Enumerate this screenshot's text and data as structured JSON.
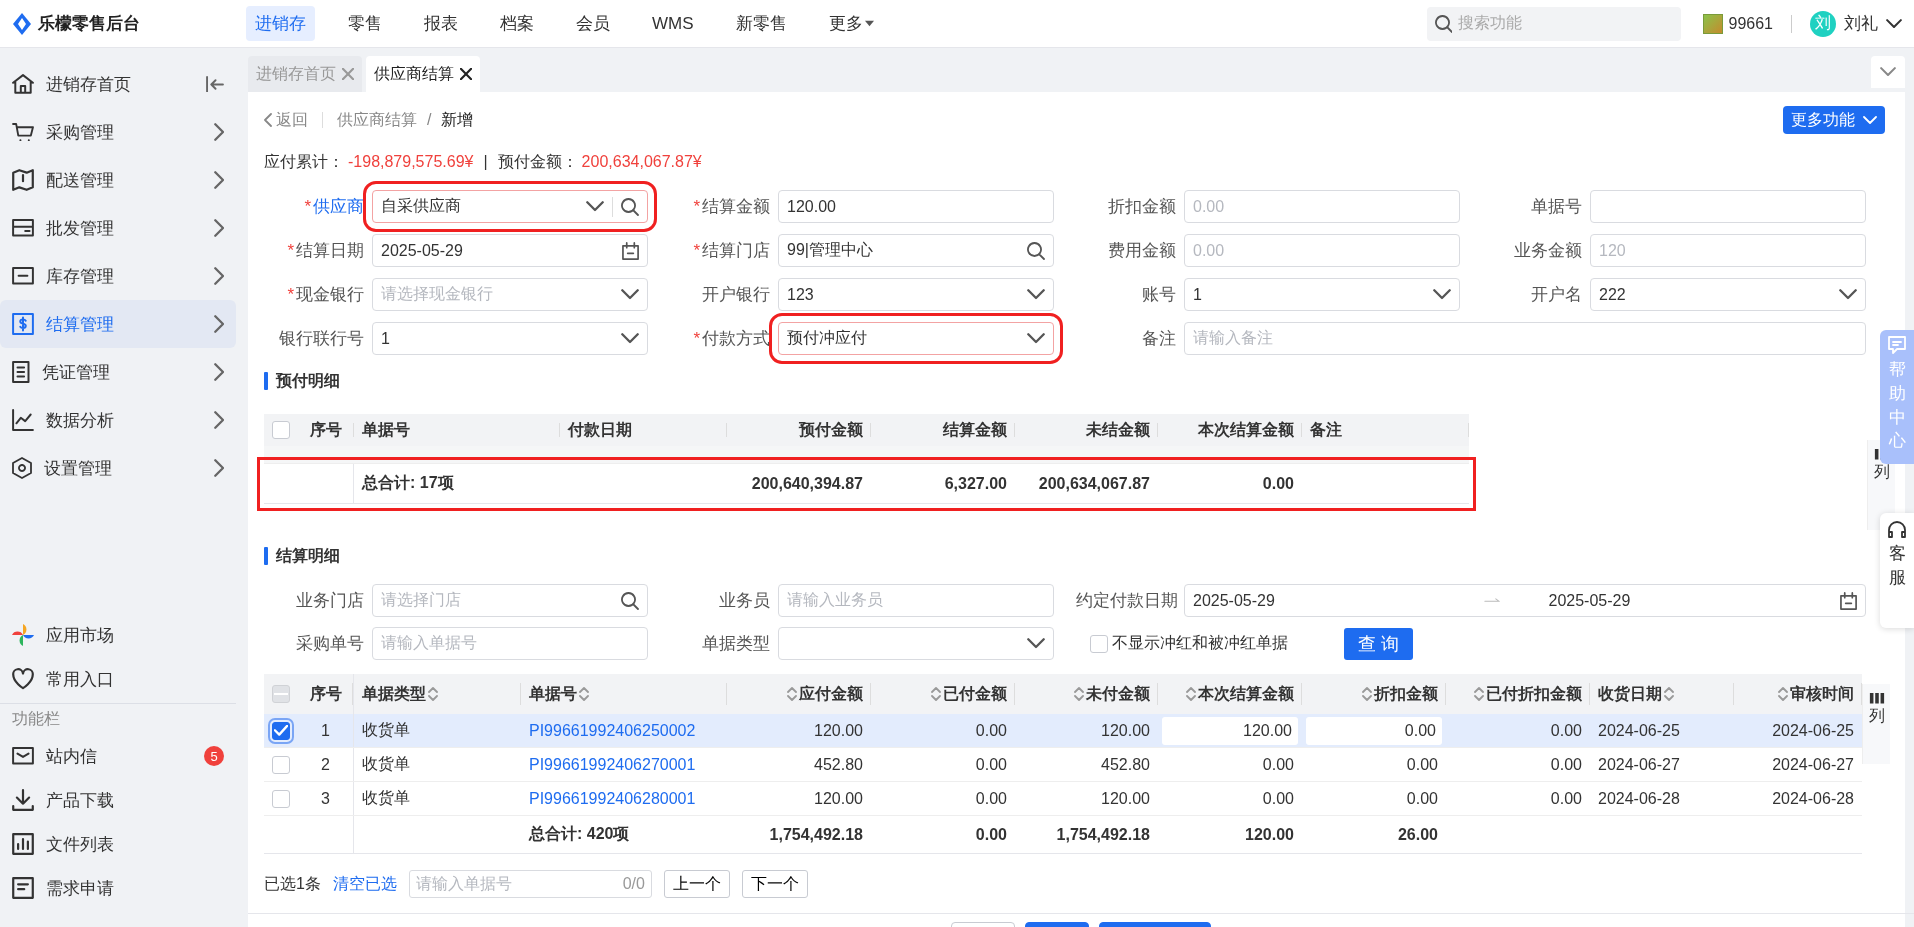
{
  "app": {
    "title": "乐檬零售后台"
  },
  "top_nav": [
    {
      "label": "进销存",
      "selected": true,
      "kind": "link"
    },
    {
      "label": "零售",
      "selected": false,
      "kind": "link"
    },
    {
      "label": "报表",
      "selected": false,
      "kind": "link"
    },
    {
      "label": "档案",
      "selected": false,
      "kind": "link"
    },
    {
      "label": "会员",
      "selected": false,
      "kind": "link"
    },
    {
      "label": "WMS",
      "selected": false,
      "kind": "link"
    },
    {
      "label": "新零售",
      "selected": false,
      "kind": "link"
    },
    {
      "label": "更多",
      "selected": false,
      "kind": "menu"
    }
  ],
  "search": {
    "placeholder": "搜索功能"
  },
  "store": {
    "code": "99661"
  },
  "user": {
    "avatar_text": "刘",
    "name": "刘礼"
  },
  "sidebar": {
    "items": [
      {
        "label": "进销存首页",
        "kind": "page",
        "selected": false
      },
      {
        "label": "采购管理",
        "kind": "group",
        "selected": false
      },
      {
        "label": "配送管理",
        "kind": "group",
        "selected": false
      },
      {
        "label": "批发管理",
        "kind": "group",
        "selected": false
      },
      {
        "label": "库存管理",
        "kind": "group",
        "selected": false
      },
      {
        "label": "结算管理",
        "kind": "group",
        "selected": true
      },
      {
        "label": "凭证管理",
        "kind": "group",
        "selected": false
      },
      {
        "label": "数据分析",
        "kind": "group",
        "selected": false
      },
      {
        "label": "设置管理",
        "kind": "group",
        "selected": false
      }
    ],
    "extra_items": [
      {
        "label": "应用市场"
      },
      {
        "label": "常用入口"
      }
    ],
    "section_title": "功能栏",
    "tool_items": [
      {
        "label": "站内信",
        "badge": "5"
      },
      {
        "label": "产品下载"
      },
      {
        "label": "文件列表"
      },
      {
        "label": "需求申请"
      }
    ]
  },
  "tabs": [
    {
      "label": "进销存首页",
      "selected": false
    },
    {
      "label": "供应商结算",
      "selected": true
    }
  ],
  "breadcrumb": {
    "back": "返回",
    "parent": "供应商结算",
    "separator": "/",
    "current": "新增"
  },
  "more_button": "更多功能",
  "summary": {
    "items": [
      {
        "label": "应付累计：",
        "value": "-198,879,575.69¥"
      },
      {
        "label": "预付金额：",
        "value": "200,634,067.87¥"
      }
    ],
    "separator": "|"
  },
  "form": {
    "required_mark": "*",
    "fields": [
      {
        "label": "供应商",
        "required": true,
        "label_link": true,
        "highlighted": true,
        "wide": false,
        "kind": "searchselect",
        "value": "自采供应商"
      },
      {
        "label": "结算金额",
        "required": true,
        "label_link": false,
        "highlighted": false,
        "wide": false,
        "kind": "text",
        "value": "120.00"
      },
      {
        "label": "折扣金额",
        "required": false,
        "label_link": false,
        "highlighted": false,
        "wide": false,
        "kind": "text",
        "placeholder": "0.00"
      },
      {
        "label": "单据号",
        "required": false,
        "label_link": false,
        "highlighted": false,
        "wide": false,
        "kind": "text"
      },
      {
        "label": "结算日期",
        "required": true,
        "label_link": false,
        "highlighted": false,
        "wide": false,
        "kind": "date",
        "value": "2025-05-29"
      },
      {
        "label": "结算门店",
        "required": true,
        "label_link": false,
        "highlighted": false,
        "wide": false,
        "kind": "search",
        "value": "99|管理中心"
      },
      {
        "label": "费用金额",
        "required": false,
        "label_link": false,
        "highlighted": false,
        "wide": false,
        "kind": "text",
        "placeholder": "0.00"
      },
      {
        "label": "业务金额",
        "required": false,
        "label_link": false,
        "highlighted": false,
        "wide": false,
        "kind": "text",
        "placeholder": "120"
      },
      {
        "label": "现金银行",
        "required": true,
        "label_link": false,
        "highlighted": false,
        "wide": false,
        "kind": "select",
        "placeholder": "请选择现金银行"
      },
      {
        "label": "开户银行",
        "required": false,
        "label_link": false,
        "highlighted": false,
        "wide": false,
        "kind": "select",
        "value": "123"
      },
      {
        "label": "账号",
        "required": false,
        "label_link": false,
        "highlighted": false,
        "wide": false,
        "kind": "select",
        "value": "1"
      },
      {
        "label": "开户名",
        "required": false,
        "label_link": false,
        "highlighted": false,
        "wide": false,
        "kind": "select",
        "value": "222"
      },
      {
        "label": "银行联行号",
        "required": false,
        "label_link": false,
        "highlighted": false,
        "wide": false,
        "kind": "select",
        "value": "1"
      },
      {
        "label": "付款方式",
        "required": true,
        "label_link": false,
        "highlighted": true,
        "wide": false,
        "kind": "select",
        "value": "预付冲应付"
      },
      {
        "label": "备注",
        "required": false,
        "label_link": false,
        "highlighted": false,
        "wide": true,
        "kind": "text",
        "placeholder": "请输入备注"
      }
    ]
  },
  "prepay": {
    "title": "预付明细",
    "column_settings": "列",
    "select_all": {
      "checked": false
    },
    "columns": [
      {
        "label": "序号",
        "kind": "index"
      },
      {
        "label": "单据号",
        "kind": "text"
      },
      {
        "label": "付款日期",
        "kind": "text"
      },
      {
        "label": "预付金额",
        "kind": "number"
      },
      {
        "label": "结算金额",
        "kind": "number"
      },
      {
        "label": "未结金额",
        "kind": "number"
      },
      {
        "label": "本次结算金额",
        "kind": "number"
      },
      {
        "label": "备注",
        "kind": "text"
      }
    ],
    "totals": {
      "label": "总合计: 17项",
      "values": [
        "200,640,394.87",
        "6,327.00",
        "200,634,067.87",
        "0.00"
      ],
      "highlighted": true
    }
  },
  "settlement": {
    "title": "结算明细",
    "filters": [
      {
        "label": "业务门店",
        "kind": "search",
        "placeholder": "请选择门店"
      },
      {
        "label": "业务员",
        "kind": "text",
        "placeholder": "请输入业务员"
      },
      {
        "label": "约定付款日期",
        "kind": "daterange",
        "start": "2025-05-29",
        "end": "2025-05-29"
      },
      {
        "label": "采购单号",
        "kind": "text",
        "placeholder": "请输入单据号"
      },
      {
        "label": "单据类型",
        "kind": "select"
      }
    ],
    "hide_reversed": {
      "label": "不显示冲红和被冲红单据",
      "checked": false
    },
    "query_button": "查 询",
    "column_settings": "列",
    "select_all": {
      "checked": false,
      "indeterminate": true
    },
    "columns": [
      {
        "label": "序号",
        "kind": "index",
        "sortable": false,
        "editable": false
      },
      {
        "label": "单据类型",
        "kind": "text",
        "sortable": true,
        "editable": false
      },
      {
        "label": "单据号",
        "kind": "link",
        "sortable": true,
        "editable": false
      },
      {
        "label": "应付金额",
        "kind": "number",
        "sortable": true,
        "editable": false
      },
      {
        "label": "已付金额",
        "kind": "number",
        "sortable": true,
        "editable": false
      },
      {
        "label": "未付金额",
        "kind": "number",
        "sortable": true,
        "editable": false
      },
      {
        "label": "本次结算金额",
        "kind": "number",
        "sortable": true,
        "editable": true
      },
      {
        "label": "折扣金额",
        "kind": "number",
        "sortable": true,
        "editable": true
      },
      {
        "label": "已付折扣金额",
        "kind": "number",
        "sortable": true,
        "editable": false
      },
      {
        "label": "收货日期",
        "kind": "text",
        "sortable": true,
        "editable": false
      },
      {
        "label": "审核时间",
        "kind": "date",
        "sortable": true,
        "editable": false
      }
    ],
    "rows": [
      {
        "selected": true,
        "cells": [
          "1",
          "收货单",
          "PI99661992406250002",
          "120.00",
          "0.00",
          "120.00",
          "120.00",
          "0.00",
          "0.00",
          "2024-06-25",
          "2024-06-25"
        ]
      },
      {
        "selected": false,
        "cells": [
          "2",
          "收货单",
          "PI99661992406270001",
          "452.80",
          "0.00",
          "452.80",
          "0.00",
          "0.00",
          "0.00",
          "2024-06-27",
          "2024-06-27"
        ]
      },
      {
        "selected": false,
        "cells": [
          "3",
          "收货单",
          "PI99661992406280001",
          "120.00",
          "0.00",
          "120.00",
          "0.00",
          "0.00",
          "0.00",
          "2024-06-28",
          "2024-06-28"
        ]
      }
    ],
    "totals": {
      "label": "总合计: 420项",
      "values": [
        "1,754,492.18",
        "0.00",
        "1,754,492.18",
        "120.00",
        "26.00"
      ]
    }
  },
  "pager": {
    "selected_count": "已选1条",
    "clear": "清空已选",
    "search_placeholder": "请输入单据号",
    "match_count": "0/0",
    "prev": "上一个",
    "next": "下一个"
  },
  "footer": {
    "buttons": [
      {
        "kind": "default"
      },
      {
        "kind": "primary"
      },
      {
        "kind": "primary"
      }
    ]
  },
  "help": {
    "help_center": "帮助中心",
    "service": "客服"
  }
}
